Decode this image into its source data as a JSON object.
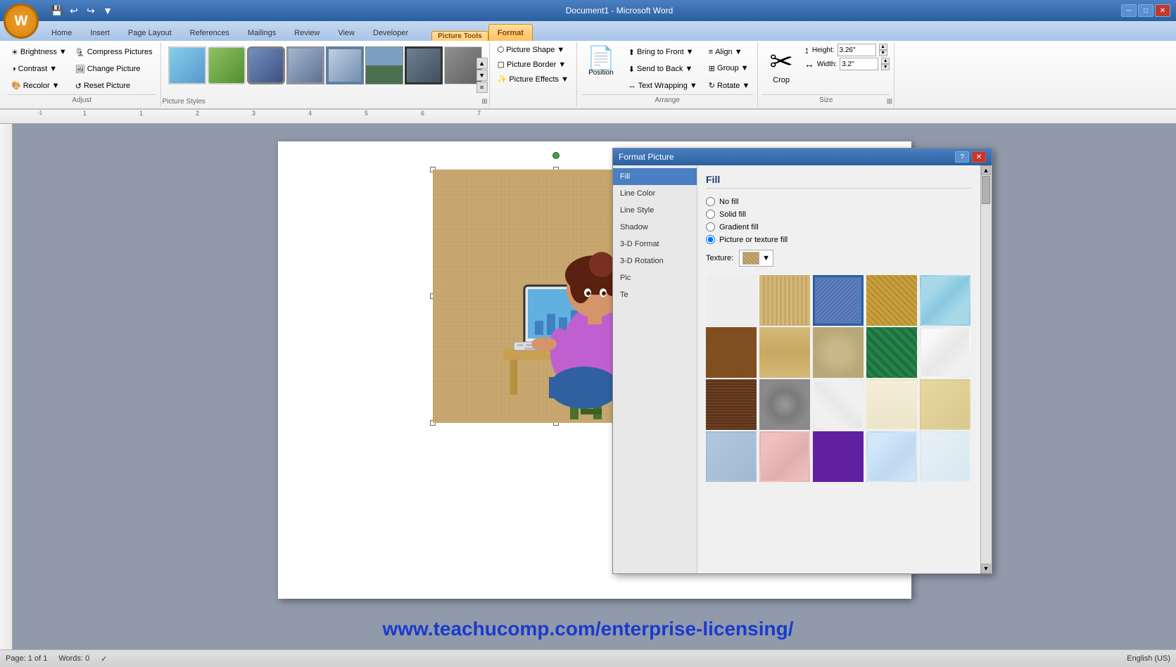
{
  "app": {
    "title": "Document1 - Microsoft Word",
    "picture_tools_label": "Picture Tools"
  },
  "window_controls": {
    "minimize": "─",
    "restore": "□",
    "close": "✕"
  },
  "qat": {
    "save": "💾",
    "undo": "↩",
    "redo": "↪",
    "more": "▼"
  },
  "tabs": [
    {
      "id": "home",
      "label": "Home",
      "active": false
    },
    {
      "id": "insert",
      "label": "Insert",
      "active": false
    },
    {
      "id": "page_layout",
      "label": "Page Layout",
      "active": false
    },
    {
      "id": "references",
      "label": "References",
      "active": false
    },
    {
      "id": "mailings",
      "label": "Mailings",
      "active": false
    },
    {
      "id": "review",
      "label": "Review",
      "active": false
    },
    {
      "id": "view",
      "label": "View",
      "active": false
    },
    {
      "id": "developer",
      "label": "Developer",
      "active": false
    },
    {
      "id": "format",
      "label": "Format",
      "active": true
    }
  ],
  "ribbon": {
    "groups": {
      "adjust": {
        "label": "Adjust",
        "brightness": "Brightness",
        "contrast": "Contrast",
        "recolor": "Recolor",
        "compress": "Compress Pictures",
        "change": "Change Picture",
        "reset": "Reset Picture"
      },
      "picture_styles": {
        "label": "Picture Styles",
        "expand_tooltip": "Picture Styles"
      },
      "arrange": {
        "label": "Arrange",
        "bring_to_front": "Bring to Front",
        "send_to_back": "Send to Back",
        "position": "Position",
        "text_wrapping": "Text Wrapping",
        "align": "Align",
        "group": "Group",
        "rotate": "Rotate"
      },
      "picture_settings": {
        "picture_shape": "Picture Shape",
        "picture_border": "Picture Border",
        "picture_effects": "Picture Effects"
      },
      "size": {
        "label": "Size",
        "crop": "Crop",
        "height_label": "Height:",
        "height_value": "3.26\"",
        "width_label": "Width:",
        "width_value": "3.2\""
      }
    }
  },
  "dialog": {
    "title": "Format Picture",
    "nav_items": [
      {
        "id": "fill",
        "label": "Fill",
        "active": true
      },
      {
        "id": "line_color",
        "label": "Line Color"
      },
      {
        "id": "line_style",
        "label": "Line Style"
      },
      {
        "id": "shadow",
        "label": "Shadow"
      },
      {
        "id": "3d_format",
        "label": "3-D Format"
      },
      {
        "id": "3d_rotation",
        "label": "3-D Rotation"
      },
      {
        "id": "pic",
        "label": "Pic"
      },
      {
        "id": "text",
        "label": "Te"
      }
    ],
    "section_title": "Fill",
    "fill_options": [
      {
        "id": "no_fill",
        "label": "No fill",
        "checked": false
      },
      {
        "id": "solid_fill",
        "label": "Solid fill",
        "checked": false
      },
      {
        "id": "gradient_fill",
        "label": "Gradient fill",
        "checked": false
      },
      {
        "id": "picture_texture_fill",
        "label": "Picture or texture fill",
        "checked": true
      }
    ],
    "texture_label": "Texture:",
    "textures": [
      {
        "id": "newsprint",
        "class": "tex-newsprint",
        "title": "Newsprint"
      },
      {
        "id": "canvas",
        "class": "tex-canvas",
        "title": "Canvas"
      },
      {
        "id": "denim",
        "class": "tex-denim",
        "title": "Denim",
        "selected": true
      },
      {
        "id": "weave",
        "class": "tex-weave",
        "title": "Woven Mat"
      },
      {
        "id": "water",
        "class": "tex-water",
        "title": "Water Droplets"
      },
      {
        "id": "brown_crinkle",
        "class": "tex-brown-crinkle",
        "title": "Brown Marble"
      },
      {
        "id": "papyrus",
        "class": "tex-papyrus",
        "title": "Papyrus"
      },
      {
        "id": "sand",
        "class": "tex-sand",
        "title": "Sand"
      },
      {
        "id": "green_marble",
        "class": "tex-green-marble",
        "title": "Green Marble"
      },
      {
        "id": "white_marble",
        "class": "tex-white-marble",
        "title": "White Marble"
      },
      {
        "id": "brown_fiber",
        "class": "tex-brown-fiber",
        "title": "Brown Fiber"
      },
      {
        "id": "gray_granite",
        "class": "tex-gray-granite",
        "title": "Gray Granite"
      },
      {
        "id": "white_fabric",
        "class": "tex-white-fabric",
        "title": "White Fabric"
      },
      {
        "id": "cream",
        "class": "tex-cream",
        "title": "Cream"
      },
      {
        "id": "tan",
        "class": "tex-tan",
        "title": "Tan"
      },
      {
        "id": "blue_tissue",
        "class": "tex-blue-tissue",
        "title": "Blue Tissue"
      },
      {
        "id": "pink",
        "class": "tex-pink",
        "title": "Pink Tissue"
      },
      {
        "id": "purple",
        "class": "tex-purple",
        "title": "Purple Mesh"
      },
      {
        "id": "light_blue",
        "class": "tex-light-blue",
        "title": "Light Blue"
      },
      {
        "id": "newsprint2",
        "class": "tex-newsprint",
        "title": "Newsprint 2"
      }
    ]
  },
  "status_bar": {
    "page": "Page: 1 of 1",
    "words": "Words: 0",
    "language": "English (US)"
  },
  "watermark": "www.teachucomp.com/enterprise-licensing/",
  "ruler": {
    "ticks": [
      "-1",
      "1",
      "1",
      "2",
      "3",
      "4",
      "5",
      "6",
      "7"
    ]
  }
}
